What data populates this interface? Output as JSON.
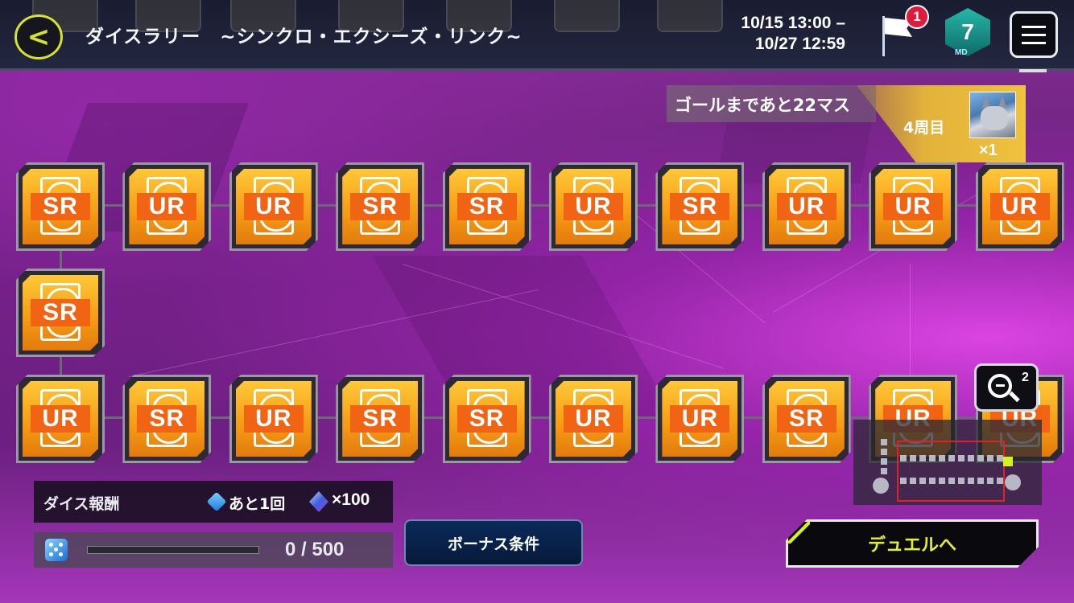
{
  "header": {
    "back_label": "<",
    "title": "ダイスラリー　~シンクロ・エクシーズ・リンク~",
    "period_start": "10/15 13:00 –",
    "period_end": "10/27 12:59",
    "flag_badge": "1",
    "md_level": "7",
    "md_label": "MD"
  },
  "goal": {
    "remaining_text": "ゴールまであと22マス",
    "lap_text": "4周目",
    "prize_qty": "×1"
  },
  "board": {
    "row1": [
      "SR",
      "UR",
      "UR",
      "SR",
      "SR",
      "UR",
      "SR",
      "UR",
      "UR",
      "UR"
    ],
    "row2": [
      "SR"
    ],
    "row3": [
      "UR",
      "SR",
      "UR",
      "SR",
      "SR",
      "UR",
      "UR",
      "SR",
      "UR",
      "UR"
    ]
  },
  "zoom": {
    "level": "2"
  },
  "dice_reward": {
    "label": "ダイス報酬",
    "remaining": "あと1回",
    "gem_qty": "×100"
  },
  "progress": {
    "current": 0,
    "max": 500,
    "text": "0 / 500"
  },
  "buttons": {
    "bonus_label": "ボーナス条件",
    "duel_label": "デュエルへ"
  },
  "colors": {
    "accent": "#d6e22e",
    "tile_gold": "#f59a14",
    "tile_band": "#f06414",
    "badge_red": "#e01a3c",
    "md_teal": "#24b8a8"
  }
}
